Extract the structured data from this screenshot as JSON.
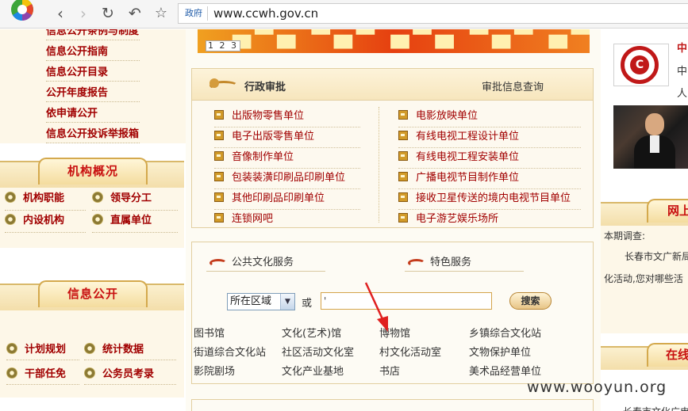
{
  "browser": {
    "url_tag": "政府",
    "url": "www.ccwh.gov.cn"
  },
  "left": {
    "info_links": [
      "信息公开条例与制度",
      "信息公开指南",
      "信息公开目录",
      "公开年度报告",
      "依申请公开",
      "信息公开投诉举报箱"
    ],
    "org_panel": {
      "title": "机构概况",
      "items": [
        "机构职能",
        "领导分工",
        "内设机构",
        "直属单位"
      ]
    },
    "open_panel": {
      "title": "信息公开",
      "items": [
        "计划规划",
        "统计数据",
        "干部任免",
        "公务员考录"
      ]
    }
  },
  "banner": {
    "pager": "1 2 3"
  },
  "approval": {
    "title": "行政审批",
    "query_link": "审批信息查询",
    "left_items": [
      "出版物零售单位",
      "电子出版零售单位",
      "音像制作单位",
      "包装装潢印刷品印刷单位",
      "其他印刷品印刷单位",
      "连锁网吧"
    ],
    "right_items": [
      "电影放映单位",
      "有线电视工程设计单位",
      "有线电视工程安装单位",
      "广播电视节目制作单位",
      "接收卫星传送的境内电视节目单位",
      "电子游艺娱乐场所"
    ]
  },
  "services": {
    "tab_public": "公共文化服务",
    "tab_feature": "特色服务",
    "region_select": "所在区域",
    "or_label": "或",
    "keyword_value": "'",
    "search_button": "搜索",
    "categories": [
      [
        "图书馆",
        "文化(艺术)馆",
        "博物馆",
        "乡镇综合文化站"
      ],
      [
        "街道综合文化站",
        "社区活动文化室",
        "村文化活动室",
        "文物保护单位"
      ],
      [
        "影院剧场",
        "文化产业基地",
        "书店",
        "美术品经营单位"
      ]
    ]
  },
  "right": {
    "headline_1": "中",
    "headline_2": "中",
    "headline_3": "人",
    "survey_title": "网上",
    "survey_label": "本期调查:",
    "survey_line_1": "长春市文广新局",
    "survey_line_2": "化活动,您对哪些活",
    "survey2_title": "在线",
    "bottom_text": "长春市文化广电"
  },
  "watermark": "www.wooyun.org"
}
